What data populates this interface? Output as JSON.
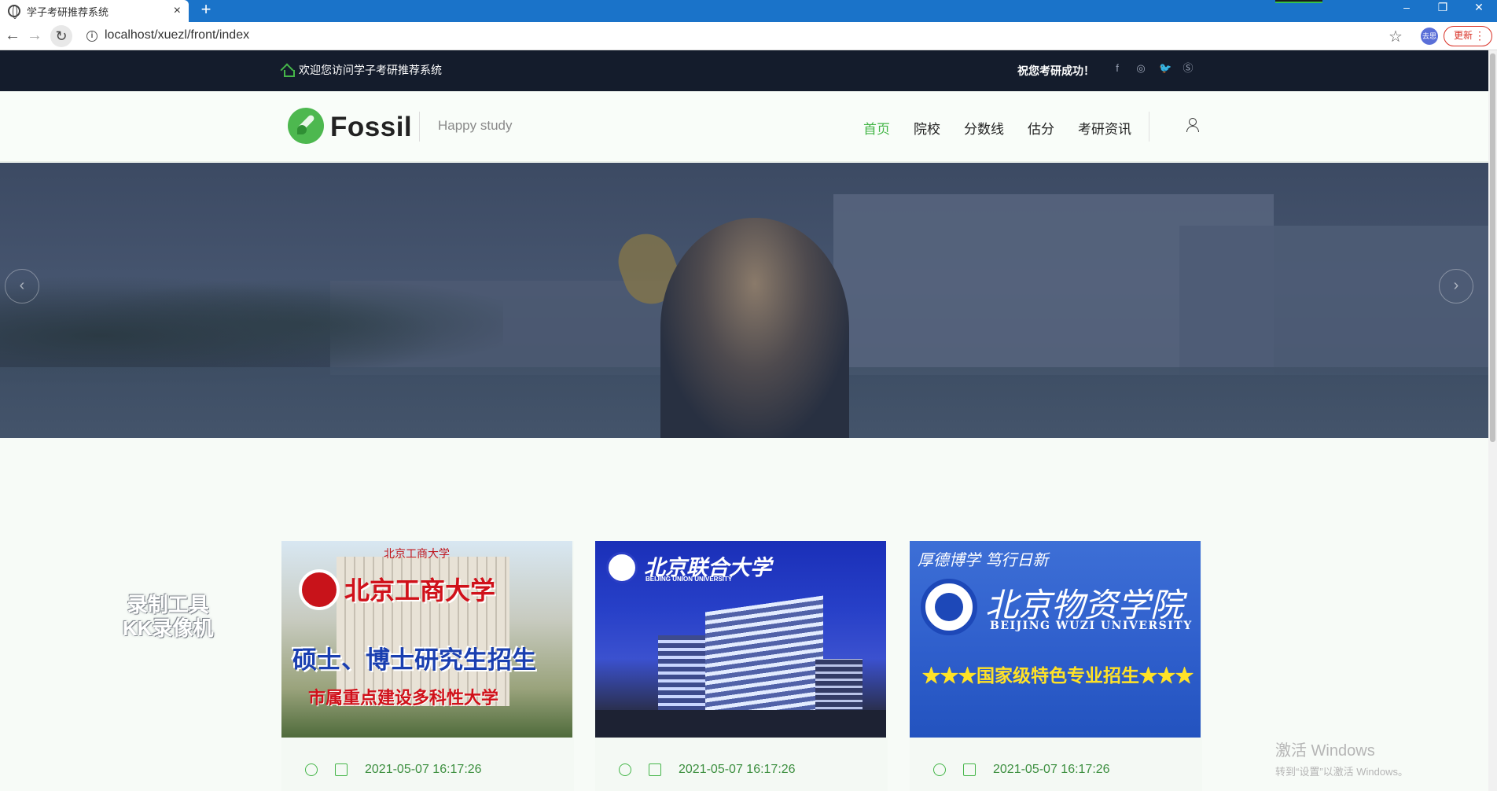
{
  "browser": {
    "tab_title": "学子考研推荐系统",
    "tab_close": "×",
    "new_tab": "+",
    "url": "localhost/xuezl/front/index",
    "profile_label": "去思",
    "update_label": "更新",
    "window_controls": [
      "–",
      "❐",
      "✕"
    ]
  },
  "topbar": {
    "welcome": "欢迎您访问学子考研推荐系统",
    "greeting": "祝您考研成功！",
    "social_icons": [
      "facebook-icon",
      "instagram-icon",
      "twitter-icon",
      "skype-icon"
    ],
    "social_glyphs": [
      "f",
      "◎",
      "🐦",
      "Ⓢ"
    ]
  },
  "header": {
    "logo_text": "Fossil",
    "tagline": "Happy study",
    "menu": [
      {
        "label": "首页",
        "active": true
      },
      {
        "label": "院校",
        "active": false
      },
      {
        "label": "分数线",
        "active": false
      },
      {
        "label": "估分",
        "active": false
      },
      {
        "label": "考研资讯",
        "active": false
      }
    ]
  },
  "hero": {
    "prev_glyph": "‹",
    "next_glyph": "›"
  },
  "cards": [
    {
      "title_lines": [
        "北京工商大学",
        "硕士、博士研究生招生",
        "市属重点建设多科性大学"
      ],
      "top_caption": "北京工商大学",
      "date": "2021-05-07 16:17:26"
    },
    {
      "title_lines": [
        "北京联合大学",
        "BEIJING UNION UNIVERSITY"
      ],
      "date": "2021-05-07 16:17:26"
    },
    {
      "title_lines": [
        "厚德博学  笃行日新",
        "北京物资学院",
        "BEIJING WUZI UNIVERSITY",
        "★★★国家级特色专业招生★★★"
      ],
      "date": "2021-05-07 16:17:26"
    }
  ],
  "overlays": {
    "recorder_line1": "录制工具",
    "recorder_line2": "KK录像机",
    "activate_title": "激活 Windows",
    "activate_sub": "转到“设置”以激活 Windows。"
  },
  "colors": {
    "accent_green": "#45b649",
    "topbar_bg": "#141c2c",
    "browser_blue": "#1a73c9"
  }
}
